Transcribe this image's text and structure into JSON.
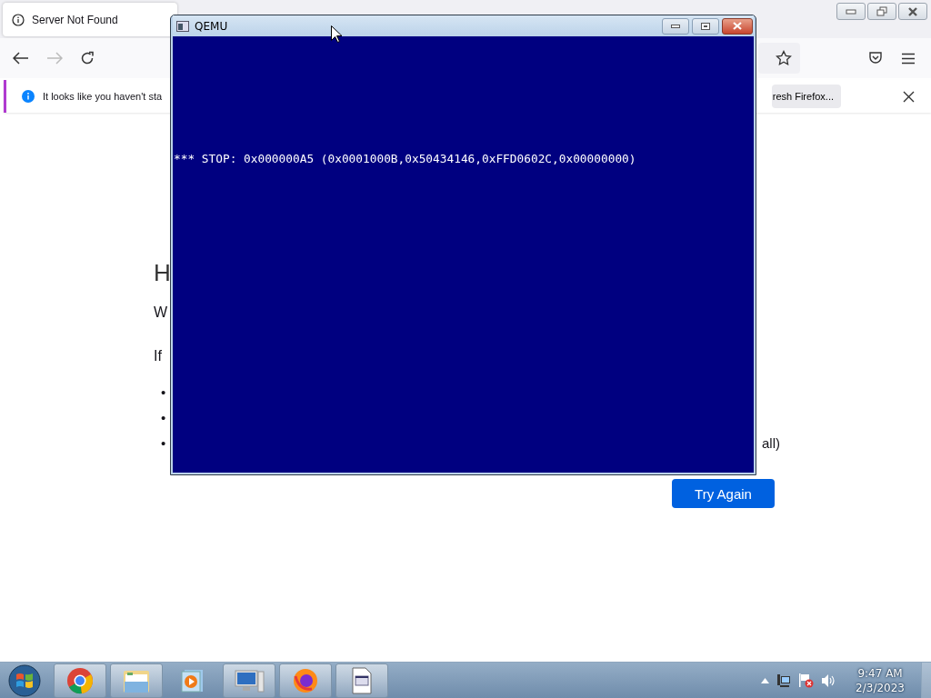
{
  "browser": {
    "tab": {
      "title": "Server Not Found",
      "selected": true
    },
    "notification": {
      "message": "It looks like you haven't sta",
      "button": "resh Firefox..."
    },
    "page": {
      "heading": "H",
      "paragraph_1": "W",
      "paragraph_2": "If",
      "list_items": [
        {
          "bullet": "•"
        },
        {
          "bullet": "•"
        },
        {
          "bullet": "•",
          "tail": "all)"
        }
      ],
      "button": "Try Again"
    }
  },
  "qemu": {
    "title": "QEMU",
    "screen_text": "*** STOP: 0x000000A5 (0x0001000B,0x50434146,0xFFD0602C,0x00000000)"
  },
  "taskbar": {
    "apps": [
      {
        "kind": "chrome",
        "running": true
      },
      {
        "kind": "folder",
        "running": true
      },
      {
        "kind": "media",
        "running": false
      },
      {
        "kind": "computer",
        "running": true
      },
      {
        "kind": "firefox",
        "running": true
      },
      {
        "kind": "document",
        "running": true
      }
    ],
    "clock": {
      "time": "9:47 AM",
      "date": "2/3/2023"
    }
  }
}
